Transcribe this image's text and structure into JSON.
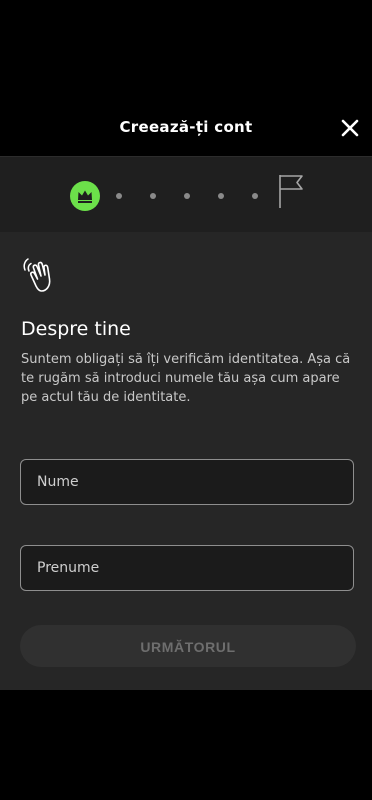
{
  "header": {
    "title": "Creează-ți cont"
  },
  "stepper": {
    "total_dots": 5,
    "icons": [
      "crown-icon",
      "flag-icon"
    ]
  },
  "main": {
    "title": "Despre tine",
    "description": "Suntem obligați să îți verificăm identitatea. Așa că te rugăm să introduci numele tău așa cum apare pe actul tău de identitate.",
    "fields": [
      {
        "placeholder": "Nume",
        "value": ""
      },
      {
        "placeholder": "Prenume",
        "value": ""
      }
    ],
    "next_label": "URMĂTORUL"
  },
  "colors": {
    "accent_green": "#6ce04a",
    "background": "#262626"
  }
}
